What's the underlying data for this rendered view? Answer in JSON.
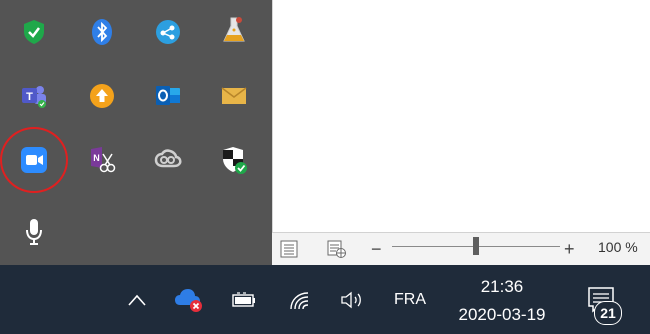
{
  "flyout": {
    "icons": [
      {
        "name": "shield-check-icon",
        "color": "#1fa84a"
      },
      {
        "name": "bluetooth-icon",
        "color": "#2f7fe8"
      },
      {
        "name": "share-network-icon",
        "color": "#2c9fe0"
      },
      {
        "name": "flask-icon",
        "color": "#e6a21f"
      },
      {
        "name": "teams-icon",
        "color": "#5059c9"
      },
      {
        "name": "upload-arrow-icon",
        "color": "#f4a21b"
      },
      {
        "name": "outlook-icon",
        "color": "#0f78d4"
      },
      {
        "name": "mail-envelope-icon",
        "color": "#e8b548"
      },
      {
        "name": "zoom-camera-icon",
        "color": "#2d8cff"
      },
      {
        "name": "onenote-scissors-icon",
        "color": "#7a3a9a"
      },
      {
        "name": "creative-cloud-icon",
        "color": "#c8c8c8"
      },
      {
        "name": "defender-shield-icon",
        "color": "#ffffff"
      },
      {
        "name": "microphone-icon",
        "color": "#ffffff"
      }
    ],
    "highlight_color": "#e02020"
  },
  "word_status": {
    "zoom_minus": "−",
    "zoom_plus": "+",
    "zoom_label": "100 %",
    "zoom_level_fraction": 0.5
  },
  "taskbar": {
    "language": "FRA",
    "time": "21:36",
    "date": "2020-03-19",
    "notification_count": "21"
  }
}
